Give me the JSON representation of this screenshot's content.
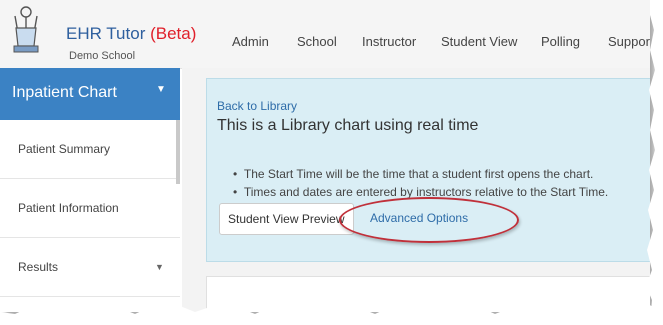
{
  "header": {
    "brand": "EHR Tutor",
    "beta": "(Beta)",
    "school": "Demo School",
    "nav": [
      {
        "label": "Admin"
      },
      {
        "label": "School"
      },
      {
        "label": "Instructor"
      },
      {
        "label": "Student View"
      },
      {
        "label": "Polling"
      },
      {
        "label": "Suppor"
      }
    ]
  },
  "sidebar": {
    "header": "Inpatient Chart",
    "items": [
      {
        "label": "Patient Summary"
      },
      {
        "label": "Patient Information"
      },
      {
        "label": "Results"
      }
    ]
  },
  "main": {
    "back_link": "Back to Library",
    "title": "This is a Library chart using real time",
    "bullets": [
      "The Start Time will be the time that a student first opens the chart.",
      "Times and dates are entered by instructors relative to the Start Time."
    ],
    "preview_button": "Student View Preview",
    "advanced_link": "Advanced Options"
  },
  "colors": {
    "brand": "#2e5f9e",
    "beta": "#e0202b",
    "sidebar_active": "#3b82c4",
    "info_panel": "#daeef5",
    "highlight_circle": "#c0303a"
  }
}
